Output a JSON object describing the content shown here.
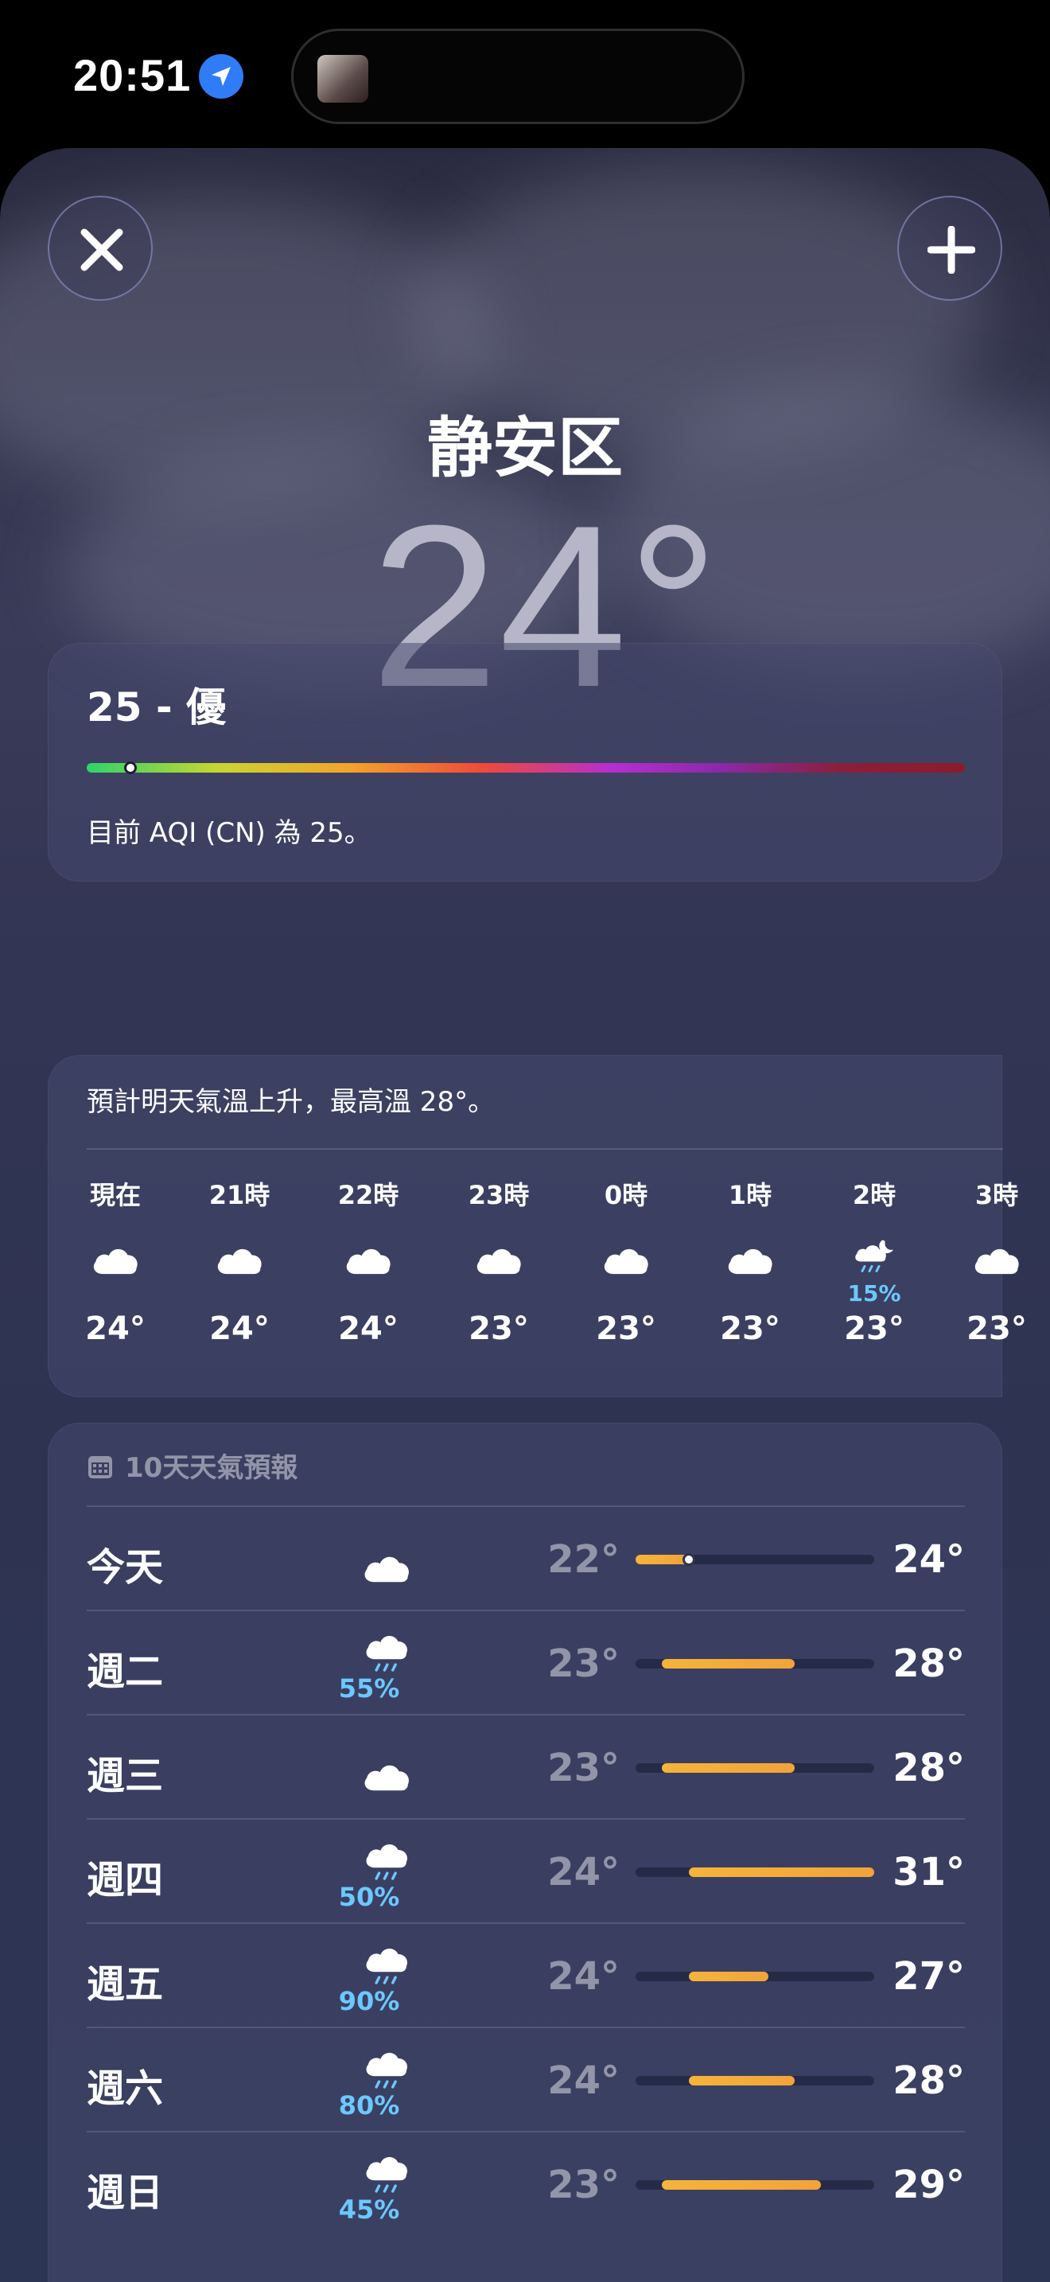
{
  "status": {
    "time": "20:51"
  },
  "location": {
    "city": "静安区",
    "temperature": "24°"
  },
  "aqi": {
    "title": "25 - 優",
    "description": "目前 AQI (CN) 為 25。",
    "value": 25,
    "scale_max": 500
  },
  "hourly": {
    "summary": "預計明天氣溫上升，最高溫 28°。",
    "items": [
      {
        "label": "現在",
        "icon": "cloud-icon",
        "temp": "24°",
        "pop": ""
      },
      {
        "label": "21時",
        "icon": "cloud-icon",
        "temp": "24°",
        "pop": ""
      },
      {
        "label": "22時",
        "icon": "cloud-icon",
        "temp": "24°",
        "pop": ""
      },
      {
        "label": "23時",
        "icon": "cloud-icon",
        "temp": "23°",
        "pop": ""
      },
      {
        "label": "0時",
        "icon": "cloud-icon",
        "temp": "23°",
        "pop": ""
      },
      {
        "label": "1時",
        "icon": "cloud-icon",
        "temp": "23°",
        "pop": ""
      },
      {
        "label": "2時",
        "icon": "cloud-moon-rain-icon",
        "temp": "23°",
        "pop": "15%"
      },
      {
        "label": "3時",
        "icon": "cloud-icon",
        "temp": "23°",
        "pop": ""
      }
    ]
  },
  "daily": {
    "header": "10天天氣預報",
    "range_min": 22,
    "range_max": 31,
    "current_temp": 24,
    "items": [
      {
        "day": "今天",
        "icon": "cloud-icon",
        "pop": "",
        "low": "22°",
        "high": "24°",
        "low_v": 22,
        "high_v": 24,
        "is_today": true
      },
      {
        "day": "週二",
        "icon": "cloud-rain-icon",
        "pop": "55%",
        "low": "23°",
        "high": "28°",
        "low_v": 23,
        "high_v": 28
      },
      {
        "day": "週三",
        "icon": "cloud-icon",
        "pop": "",
        "low": "23°",
        "high": "28°",
        "low_v": 23,
        "high_v": 28
      },
      {
        "day": "週四",
        "icon": "cloud-rain-icon",
        "pop": "50%",
        "low": "24°",
        "high": "31°",
        "low_v": 24,
        "high_v": 31
      },
      {
        "day": "週五",
        "icon": "cloud-rain-icon",
        "pop": "90%",
        "low": "24°",
        "high": "27°",
        "low_v": 24,
        "high_v": 27
      },
      {
        "day": "週六",
        "icon": "cloud-rain-icon",
        "pop": "80%",
        "low": "24°",
        "high": "28°",
        "low_v": 24,
        "high_v": 28
      },
      {
        "day": "週日",
        "icon": "cloud-rain-icon",
        "pop": "45%",
        "low": "23°",
        "high": "29°",
        "low_v": 23,
        "high_v": 29
      }
    ]
  }
}
